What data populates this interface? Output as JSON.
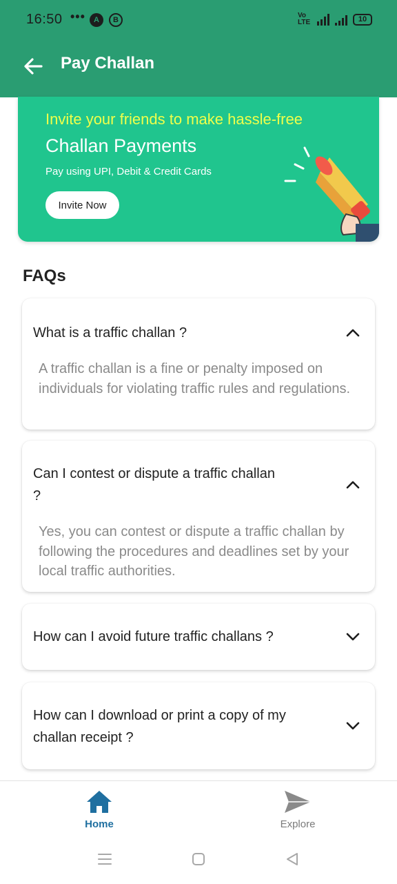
{
  "status_bar": {
    "time": "16:50",
    "dots": "•••",
    "badge_a": "A",
    "badge_b": "B",
    "volte": "Vo LTE",
    "network": "4G",
    "battery": "10"
  },
  "header": {
    "title": "Pay Challan",
    "back_icon": "arrow-left-icon"
  },
  "banner": {
    "headline": "Invite your friends to make hassle-free",
    "title": "Challan Payments",
    "subtitle": "Pay using UPI, Debit & Credit Cards",
    "button_label": "Invite Now",
    "illustration": "megaphone-icon"
  },
  "faqs": {
    "heading": "FAQs",
    "items": [
      {
        "question": "What is a traffic challan ?",
        "answer": "A traffic challan is a fine or penalty imposed on individuals for violating traffic rules and regulations.",
        "expanded": true
      },
      {
        "question": "Can I contest or dispute a traffic challan ?",
        "answer": "Yes, you can contest or dispute a traffic challan by following the procedures and deadlines set by your local traffic authorities.",
        "expanded": true
      },
      {
        "question": "How can I avoid future traffic challans ?",
        "answer": "",
        "expanded": false
      },
      {
        "question": "How can I download or print a copy of my challan receipt ?",
        "answer": "",
        "expanded": false
      }
    ]
  },
  "bottom_nav": {
    "items": [
      {
        "label": "Home",
        "icon": "home-icon",
        "active": true
      },
      {
        "label": "Explore",
        "icon": "send-icon",
        "active": false
      }
    ]
  },
  "colors": {
    "primary": "#2a9d72",
    "banner": "#20c58e",
    "headline": "#f0ff4a",
    "active_nav": "#1f6fa0"
  }
}
